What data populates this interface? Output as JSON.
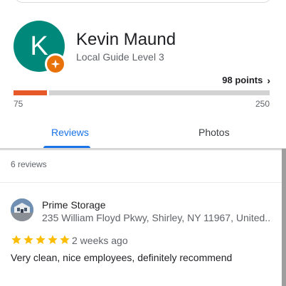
{
  "profile": {
    "avatar_letter": "K",
    "name": "Kevin Maund",
    "level": "Local Guide Level 3",
    "points": "98 points",
    "progress": {
      "min_label": "75",
      "max_label": "250",
      "fill_fraction": 0.13
    },
    "accent_color": "#00897b",
    "badge_color": "#e8710a"
  },
  "tabs": [
    {
      "label": "Reviews",
      "active": true
    },
    {
      "label": "Photos",
      "active": false
    }
  ],
  "reviews_section": {
    "count": "6 reviews",
    "items": [
      {
        "place_name": "Prime Storage",
        "address": "235 William Floyd Pkwy, Shirley, NY 11967, United...",
        "rating": 5,
        "time": "2 weeks ago",
        "text": "Very clean, nice employees, definitely recommend"
      }
    ]
  },
  "colors": {
    "link_blue": "#1a73e8",
    "star_gold": "#fbbc04",
    "progress_orange": "#e8592a"
  }
}
